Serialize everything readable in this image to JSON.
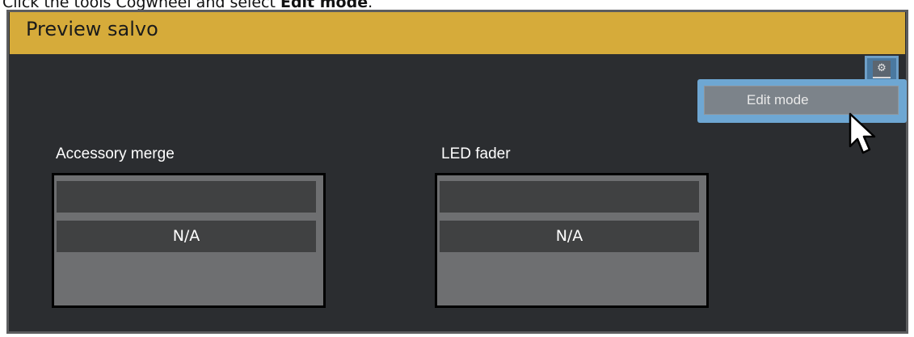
{
  "instruction": {
    "prefix": "Click the tools Cogwheel and select ",
    "bold": "Edit mode",
    "suffix": "."
  },
  "panel": {
    "title": "Preview salvo",
    "header_color": "#d6ab3a"
  },
  "toolbar": {
    "gear_icon": "gear-icon"
  },
  "menu": {
    "items": [
      {
        "label": "Edit mode"
      }
    ]
  },
  "devices": [
    {
      "label": "Accessory merge",
      "top_value": "",
      "value": "N/A"
    },
    {
      "label": "LED fader",
      "top_value": "",
      "value": "N/A"
    }
  ]
}
